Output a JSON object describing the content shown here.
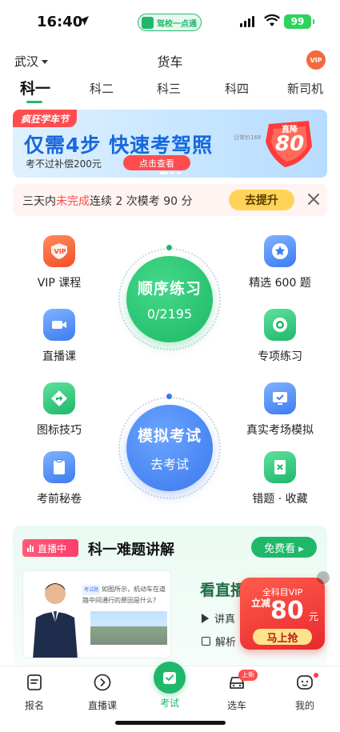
{
  "status_bar": {
    "time": "16:40",
    "app_pill": "驾校一点通",
    "battery": "99"
  },
  "header": {
    "city": "武汉",
    "vehicle_type": "货车",
    "vip": "VIP"
  },
  "tabs": [
    {
      "label": "科一"
    },
    {
      "label": "科二"
    },
    {
      "label": "科三"
    },
    {
      "label": "科四"
    },
    {
      "label": "新司机"
    }
  ],
  "banner": {
    "tag": "疯狂学车节",
    "headline": "仅需4步 快速考驾照",
    "subtext": "考不过补偿200元",
    "button": "点击查看",
    "daily_price": "日常价168",
    "discount_label": "直降",
    "discount_value": "80"
  },
  "notice": {
    "prefix": "三天内",
    "highlight": "未完成",
    "suffix": "连续 2 次模考 90 分",
    "button": "去提升"
  },
  "features": {
    "vip": "VIP 课程",
    "selected": "精选 600 题",
    "live": "直播课",
    "topic": "专项练习",
    "signs": "图标技巧",
    "real_sim": "真实考场模拟",
    "secret": "考前秘卷",
    "wrong": "错题 · 收藏"
  },
  "practice": {
    "title": "顺序练习",
    "progress": "0/2195"
  },
  "mock": {
    "title": "模拟考试",
    "subtitle": "去考试"
  },
  "live_section": {
    "badge": "直播中",
    "title": "科一难题讲解",
    "button": "免费看 ▸",
    "thumb_tag": "考试题",
    "thumb_question": "如图所示，机动车在道路中间通行的原因是什么?",
    "watch_title": "看直播",
    "items": [
      "讲真",
      "解析"
    ]
  },
  "promo": {
    "top": "全科目VIP",
    "off_label": "立减",
    "amount": "80",
    "unit": "元",
    "button": "马上抢"
  },
  "tabbar": [
    {
      "label": "报名"
    },
    {
      "label": "直播课"
    },
    {
      "label": "考试"
    },
    {
      "label": "选车",
      "badge": "上新"
    },
    {
      "label": "我的"
    }
  ],
  "colors": {
    "brand_green": "#1fb86b",
    "accent_red": "#ff4d4f",
    "accent_blue": "#3d7cf0"
  }
}
